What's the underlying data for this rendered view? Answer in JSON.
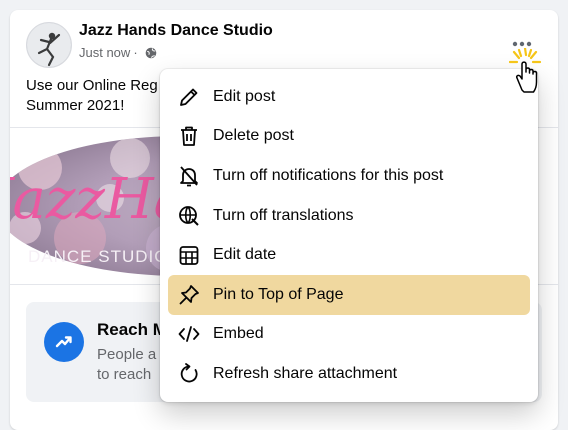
{
  "post": {
    "page_name": "Jazz Hands Dance Studio",
    "timestamp": "Just now",
    "separator": "·",
    "privacy_icon": "globe-icon",
    "text_line1": "Use our Online Reg",
    "text_line2": "Summer 2021!",
    "image": {
      "logo_text": "JazzHands",
      "logo_subtext": "DANCE STUDIO"
    },
    "more_icon": "more-horizontal-icon"
  },
  "promo": {
    "title": "Reach M",
    "desc_line1": "People a",
    "desc_line2": "to reach",
    "icon": "trend-up-icon",
    "accent_color": "#1b74e4"
  },
  "menu": {
    "items": [
      {
        "label": "Edit post",
        "icon": "pencil-icon"
      },
      {
        "label": "Delete post",
        "icon": "trash-icon"
      },
      {
        "label": "Turn off notifications for this post",
        "icon": "bell-off-icon"
      },
      {
        "label": "Turn off translations",
        "icon": "globe-translate-icon"
      },
      {
        "label": "Edit date",
        "icon": "calendar-icon"
      },
      {
        "label": "Pin to Top of Page",
        "icon": "pin-icon",
        "highlighted": true
      },
      {
        "label": "Embed",
        "icon": "code-icon"
      },
      {
        "label": "Refresh share attachment",
        "icon": "refresh-icon"
      }
    ],
    "highlight_color": "#f0d89f"
  },
  "cursor": {
    "icon": "hand-pointer-icon"
  }
}
